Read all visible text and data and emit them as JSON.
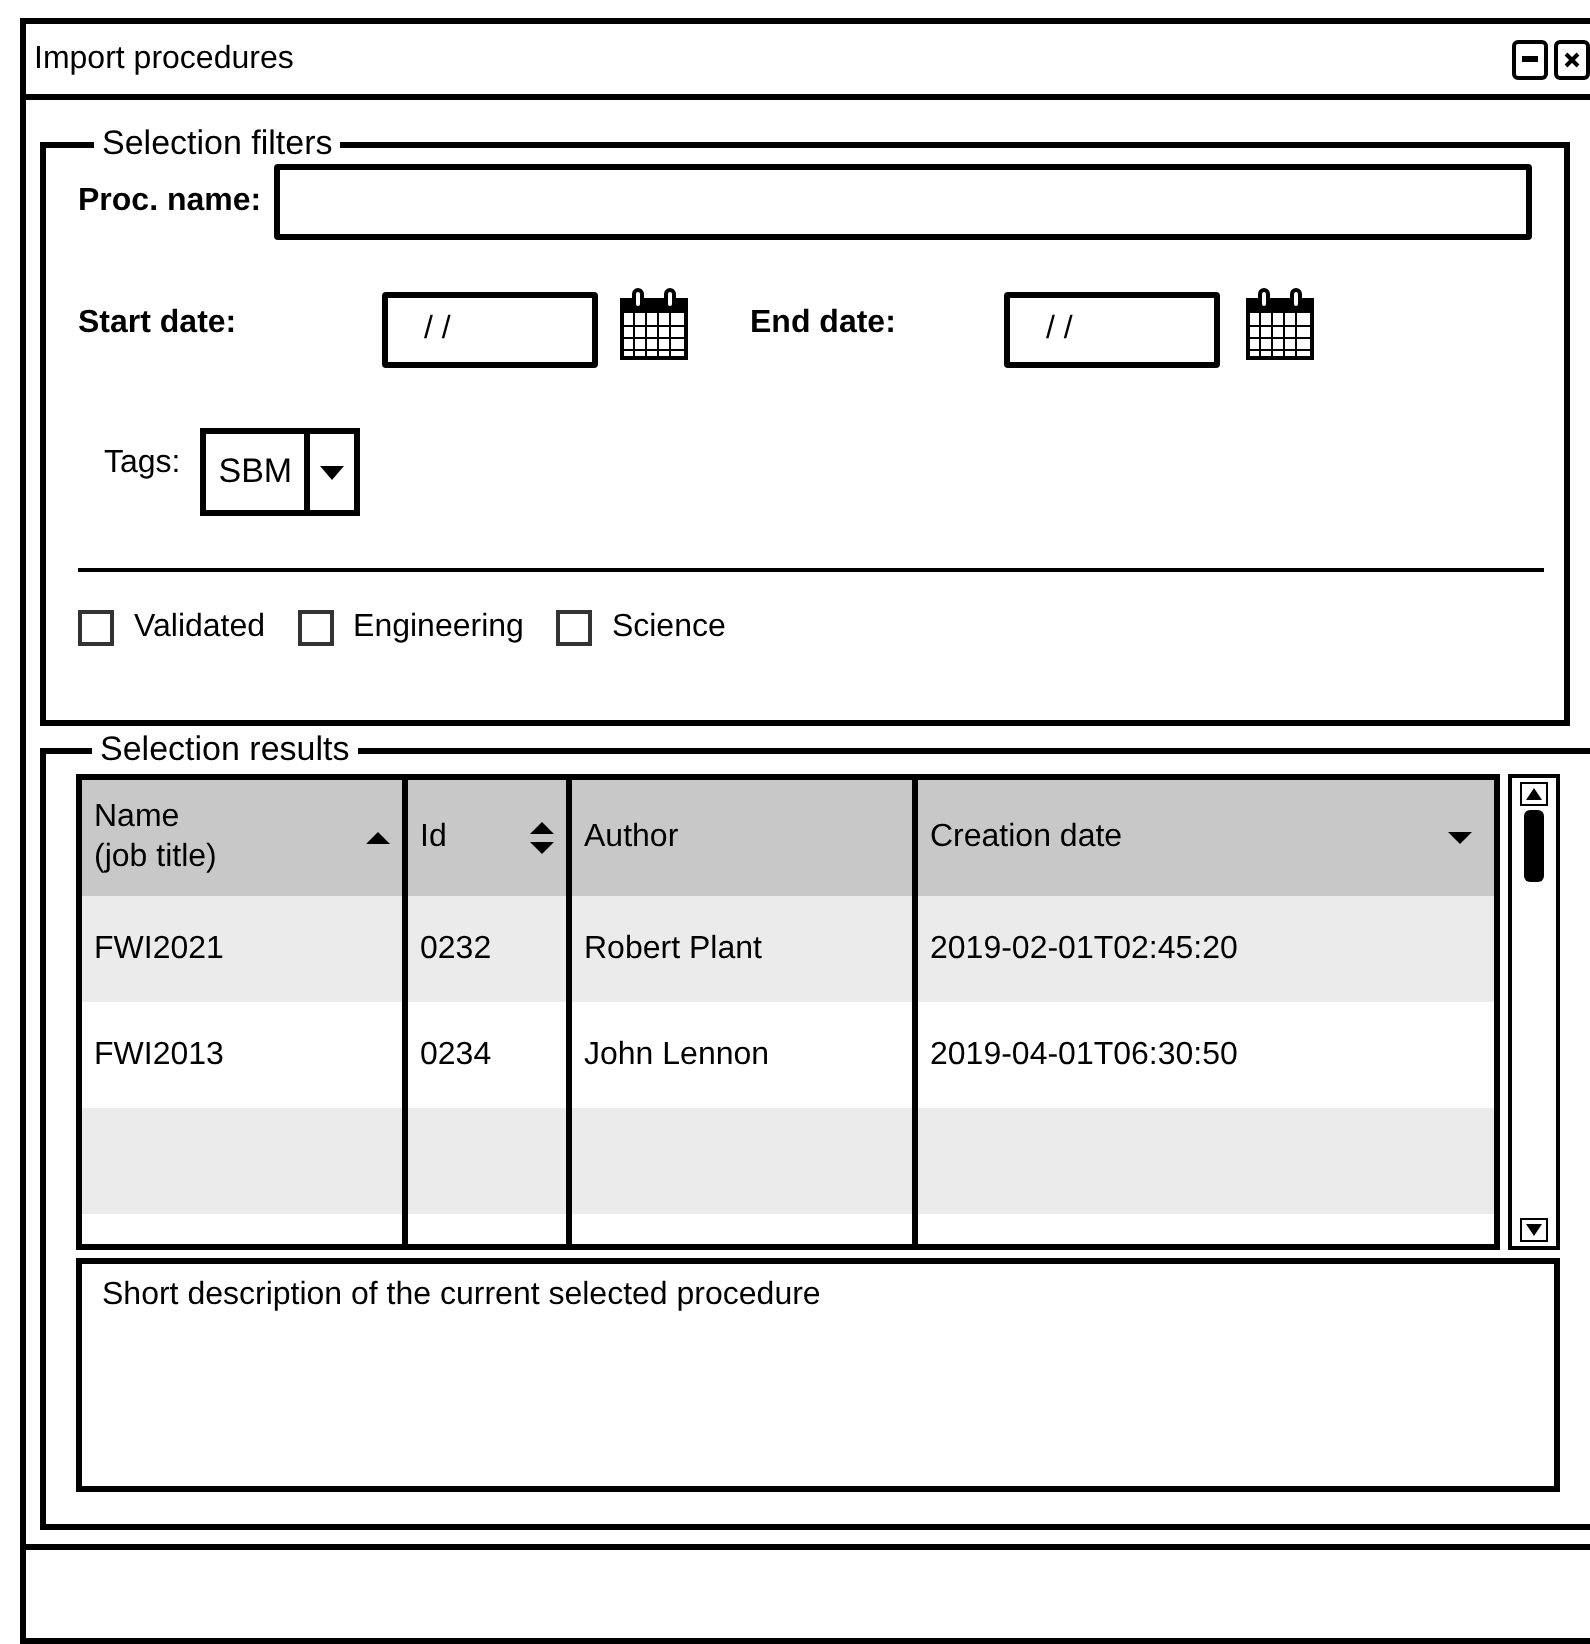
{
  "window": {
    "title": "Import procedures"
  },
  "filters": {
    "title": "Selection filters",
    "proc_name": {
      "label": "Proc. name:"
    },
    "start_date": {
      "label": "Start date:",
      "value": "/ /"
    },
    "end_date": {
      "label": "End date:",
      "value": "/ /"
    },
    "tags": {
      "label": "Tags:",
      "value": "SBM"
    },
    "checkboxes": [
      {
        "label": "Validated",
        "checked": false
      },
      {
        "label": "Engineering",
        "checked": false
      },
      {
        "label": "Science",
        "checked": false
      }
    ]
  },
  "results": {
    "title": "Selection results",
    "table": {
      "columns": [
        {
          "label": "Name\n(job title)",
          "kind": "ascending"
        },
        {
          "label": "Id",
          "kind": "sortable"
        },
        {
          "label": "Author",
          "kind": "plain"
        },
        {
          "label": "Creation date",
          "kind": "descending"
        }
      ],
      "rows": [
        [
          "FWI2021",
          "0232",
          "Robert Plant",
          "2019-02-01T02:45:20"
        ],
        [
          "FWI2013",
          "0234",
          "John Lennon",
          "2019-04-01T06:30:50"
        ]
      ]
    },
    "description": "Short description of the current selected procedure"
  }
}
